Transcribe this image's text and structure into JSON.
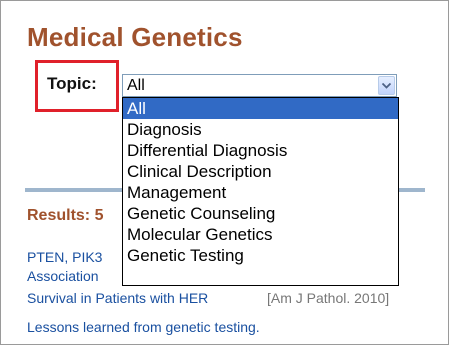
{
  "page": {
    "title": "Medical Genetics"
  },
  "filter": {
    "label": "Topic:",
    "selected": "All",
    "options": [
      "All",
      "Diagnosis",
      "Differential Diagnosis",
      "Clinical Description",
      "Management",
      "Genetic Counseling",
      "Molecular Genetics",
      "Genetic Testing"
    ]
  },
  "results": {
    "heading": "Results: 5",
    "items": [
      {
        "line1": "PTEN, PIK3",
        "line2": "Association",
        "line3": "Survival in Patients with HER",
        "citation": "[Am J Pathol. 2010]",
        "suffix": "."
      },
      {
        "line1": "Lessons learned from genetic testing."
      }
    ]
  },
  "colors": {
    "heading": "#a0522d",
    "link": "#1a50a0",
    "highlight": "#316ac5",
    "topic_border": "#e0202a"
  }
}
